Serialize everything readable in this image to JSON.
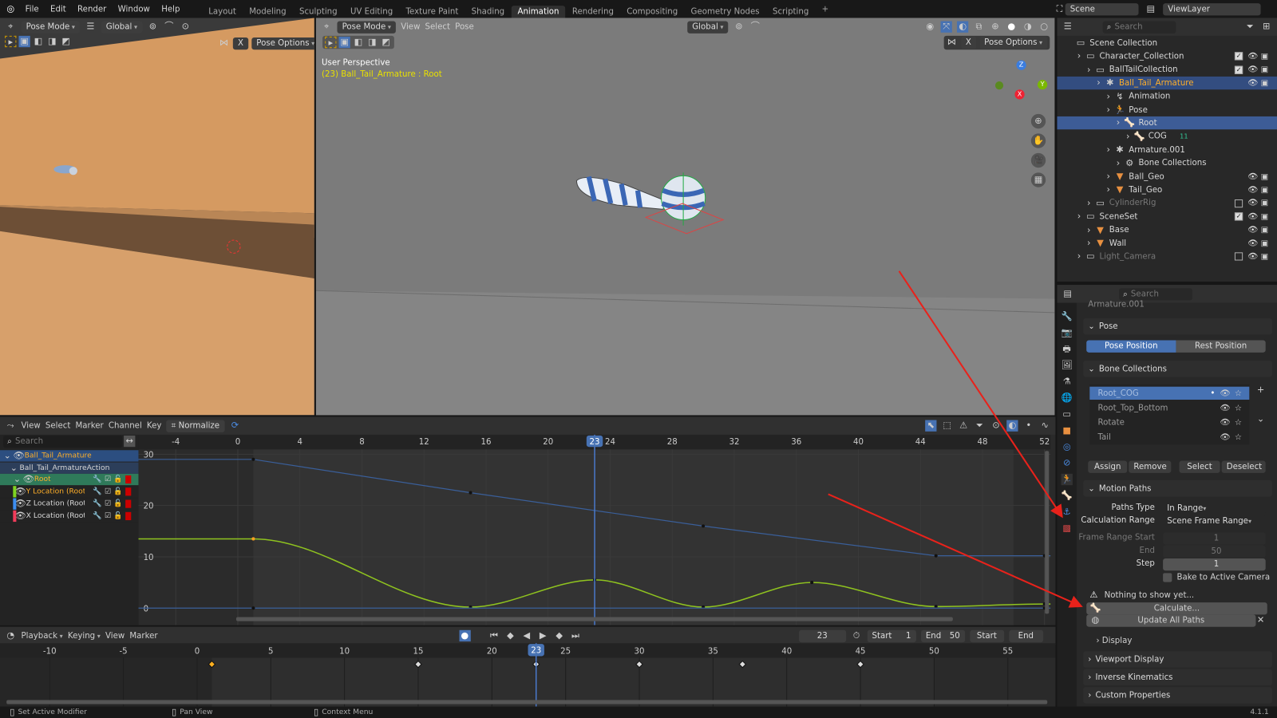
{
  "topbar": {
    "menus": [
      "File",
      "Edit",
      "Render",
      "Window",
      "Help"
    ],
    "workspaces": [
      "Layout",
      "Modeling",
      "Sculpting",
      "UV Editing",
      "Texture Paint",
      "Shading",
      "Animation",
      "Rendering",
      "Compositing",
      "Geometry Nodes",
      "Scripting"
    ],
    "active_workspace": "Animation",
    "scene": "Scene",
    "view_layer": "ViewLayer"
  },
  "left_viewport": {
    "mode": "Pose Mode",
    "orientation": "Global",
    "pose_options": "Pose Options",
    "mirror_x": "X"
  },
  "main_viewport": {
    "mode": "Pose Mode",
    "menus": [
      "View",
      "Select",
      "Pose"
    ],
    "orientation": "Global",
    "pose_options": "Pose Options",
    "mirror_x": "X",
    "perspective": "User Perspective",
    "object_info": "(23) Ball_Tail_Armature : Root",
    "gizmo_axes": [
      "Z",
      "Y",
      "X"
    ]
  },
  "outliner": {
    "search_placeholder": "Search",
    "rows": [
      {
        "label": "Scene Collection",
        "depth": 0,
        "icon": "collection-icon",
        "color": "#d8d8d8"
      },
      {
        "label": "Character_Collection",
        "depth": 1,
        "icon": "collection-icon",
        "check": true,
        "eye": true,
        "color": "#d8d8d8"
      },
      {
        "label": "BallTailCollection",
        "depth": 2,
        "icon": "collection-icon",
        "check": true,
        "eye": true,
        "color": "#d8d8d8"
      },
      {
        "label": "Ball_Tail_Armature",
        "depth": 3,
        "icon": "armature-icon",
        "eye": true,
        "selected": true,
        "color": "#ffaf29"
      },
      {
        "label": "Animation",
        "depth": 4,
        "icon": "animation-icon",
        "color": "#d8d8d8"
      },
      {
        "label": "Pose",
        "depth": 4,
        "icon": "pose-icon",
        "color": "#d8d8d8"
      },
      {
        "label": "Root",
        "depth": 5,
        "icon": "bone-icon",
        "active": true,
        "color": "#d8d8d8"
      },
      {
        "label": "COG",
        "depth": 6,
        "icon": "bone-icon",
        "badge": "11",
        "color": "#d8d8d8"
      },
      {
        "label": "Armature.001",
        "depth": 4,
        "icon": "armature-data-icon",
        "color": "#d8d8d8"
      },
      {
        "label": "Bone Collections",
        "depth": 5,
        "icon": "bone-collections-icon",
        "color": "#d8d8d8"
      },
      {
        "label": "Ball_Geo",
        "depth": 4,
        "icon": "mesh-icon",
        "eye": true,
        "color": "#d8d8d8"
      },
      {
        "label": "Tail_Geo",
        "depth": 4,
        "icon": "mesh-icon",
        "eye": true,
        "color": "#d8d8d8"
      },
      {
        "label": "CylinderRig",
        "depth": 2,
        "icon": "collection-icon",
        "check": false,
        "eye": true,
        "color": "#777"
      },
      {
        "label": "SceneSet",
        "depth": 1,
        "icon": "collection-icon",
        "check": true,
        "eye": true,
        "color": "#d8d8d8"
      },
      {
        "label": "Base",
        "depth": 2,
        "icon": "mesh-icon",
        "eye": true,
        "color": "#d8d8d8"
      },
      {
        "label": "Wall",
        "depth": 2,
        "icon": "mesh-icon",
        "eye": true,
        "color": "#d8d8d8"
      },
      {
        "label": "Light_Camera",
        "depth": 1,
        "icon": "collection-icon",
        "check": false,
        "eye": true,
        "color": "#777"
      }
    ]
  },
  "properties": {
    "search_placeholder": "Search",
    "data_name": "Armature.001",
    "pose_panel": "Pose",
    "pose_position": "Pose Position",
    "rest_position": "Rest Position",
    "bone_collections_panel": "Bone Collections",
    "bone_collections": [
      "Root_COG",
      "Root_Top_Bottom",
      "Rotate",
      "Tail"
    ],
    "active_bone_collection": "Root_COG",
    "assign": "Assign",
    "remove": "Remove",
    "select": "Select",
    "deselect": "Deselect",
    "motion_paths_panel": "Motion Paths",
    "paths_type_label": "Paths Type",
    "paths_type": "In Range",
    "calc_range_label": "Calculation Range",
    "calc_range": "Scene Frame Range",
    "frame_start_label": "Frame Range Start",
    "frame_start": "1",
    "end_label": "End",
    "end": "50",
    "step_label": "Step",
    "step": "1",
    "bake_label": "Bake to Active Camera",
    "warning": "Nothing to show yet...",
    "calculate": "Calculate...",
    "update_all": "Update All Paths",
    "display": "Display",
    "viewport_display": "Viewport Display",
    "inverse_kinematics": "Inverse Kinematics",
    "custom_properties": "Custom Properties"
  },
  "graph_editor": {
    "menus": [
      "View",
      "Select",
      "Marker",
      "Channel",
      "Key"
    ],
    "normalize": "Normalize",
    "search_placeholder": "Search",
    "current_frame": "23",
    "x_ticks": [
      -4,
      0,
      4,
      8,
      12,
      16,
      20,
      24,
      28,
      32,
      36,
      40,
      44,
      48,
      52
    ],
    "y_ticks": [
      30,
      20,
      10,
      0
    ],
    "channels": [
      {
        "label": "Ball_Tail_Armature",
        "type": "object",
        "color": "#ffaf29"
      },
      {
        "label": "Ball_Tail_ArmatureAction",
        "type": "action",
        "color": "#d8d8d8"
      },
      {
        "label": "Root",
        "type": "group",
        "color": "#ffaf29"
      },
      {
        "label": "Y Location (Root)",
        "type": "fcurve",
        "swatch": "#7ed321",
        "color": "#ffaf29"
      },
      {
        "label": "Z Location (Root)",
        "type": "fcurve",
        "swatch": "#3c8ef0",
        "color": "#d8d8d8"
      },
      {
        "label": "X Location (Root)",
        "type": "fcurve",
        "swatch": "#f03c5a",
        "color": "#d8d8d8"
      }
    ],
    "curves": [
      {
        "channel": "Y Location (Root)",
        "color": "#8fc31f",
        "keys": [
          [
            1,
            13.5
          ],
          [
            15,
            0.2
          ],
          [
            23,
            5.5
          ],
          [
            30,
            0.2
          ],
          [
            37,
            5
          ],
          [
            45,
            0.3
          ],
          [
            52,
            0.8
          ]
        ]
      },
      {
        "channel": "Z Location (Root)",
        "color": "#3a5f9a",
        "keys": [
          [
            1,
            29
          ],
          [
            15,
            22.5
          ],
          [
            30,
            16
          ],
          [
            45,
            10.2
          ],
          [
            52,
            10.2
          ]
        ]
      },
      {
        "channel": "X Location (Root)",
        "color": "#3a5f9a",
        "keys": [
          [
            1,
            0
          ],
          [
            52,
            0
          ]
        ]
      }
    ]
  },
  "timeline": {
    "menus": [
      "Playback",
      "Keying",
      "View",
      "Marker"
    ],
    "current_frame": "23",
    "start_label": "Start",
    "start": "1",
    "end_label": "End",
    "end": "50",
    "start_btn": "Start",
    "end_btn": "End",
    "ticks": [
      -10,
      -5,
      0,
      5,
      10,
      15,
      20,
      25,
      30,
      35,
      40,
      45,
      50,
      55
    ],
    "keyframes": [
      1,
      15,
      23,
      30,
      37,
      45
    ],
    "selected_keyframe": 1
  },
  "statusbar": {
    "left": "Set Active Modifier",
    "middle": "Pan View",
    "right": "Context Menu",
    "version": "4.1.1"
  }
}
